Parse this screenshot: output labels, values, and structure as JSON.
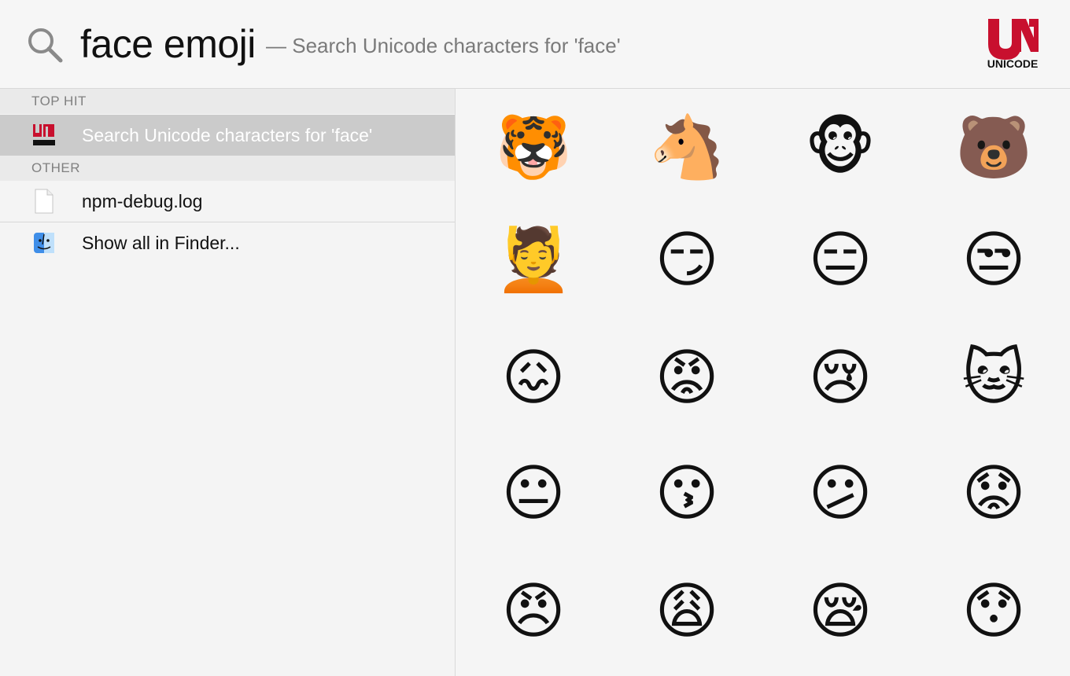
{
  "search": {
    "query": "face emoji",
    "hint": "— Search Unicode characters for 'face'",
    "search_icon": "magnifying-glass-icon",
    "app_logo_text": "UNICODE"
  },
  "results": {
    "top_hit_header": "TOP HIT",
    "top_hit": {
      "label": "Search Unicode characters for 'face'",
      "icon": "unicode-app-icon"
    },
    "other_header": "OTHER",
    "other": [
      {
        "label": "npm-debug.log",
        "icon": "document-icon"
      }
    ],
    "show_all": {
      "label": "Show all in Finder...",
      "icon": "finder-icon"
    }
  },
  "emoji_grid": [
    {
      "char": "🐯",
      "name": "tiger-face"
    },
    {
      "char": "🐴",
      "name": "horse-face"
    },
    {
      "char": "🐵",
      "name": "monkey-face"
    },
    {
      "char": "🐻",
      "name": "bear-face"
    },
    {
      "char": "💆",
      "name": "face-massage"
    },
    {
      "char": "😏",
      "name": "smirking-face"
    },
    {
      "char": "😑",
      "name": "expressionless-face"
    },
    {
      "char": "😒",
      "name": "unamused-face"
    },
    {
      "char": "😖",
      "name": "confounded-face"
    },
    {
      "char": "😡",
      "name": "pouting-face"
    },
    {
      "char": "😢",
      "name": "crying-face"
    },
    {
      "char": "🐱",
      "name": "cat-face"
    },
    {
      "char": "😐",
      "name": "neutral-face"
    },
    {
      "char": "😗",
      "name": "kissing-face"
    },
    {
      "char": "😕",
      "name": "confused-face"
    },
    {
      "char": "😟",
      "name": "worried-face"
    },
    {
      "char": "😠",
      "name": "angry-face"
    },
    {
      "char": "😩",
      "name": "weary-face"
    },
    {
      "char": "😪",
      "name": "sleepy-face"
    },
    {
      "char": "😯",
      "name": "hushed-face"
    }
  ],
  "colors": {
    "selection": "#cbcbcb",
    "section_header": "#eaeaea",
    "logo_red": "#c8102e"
  }
}
